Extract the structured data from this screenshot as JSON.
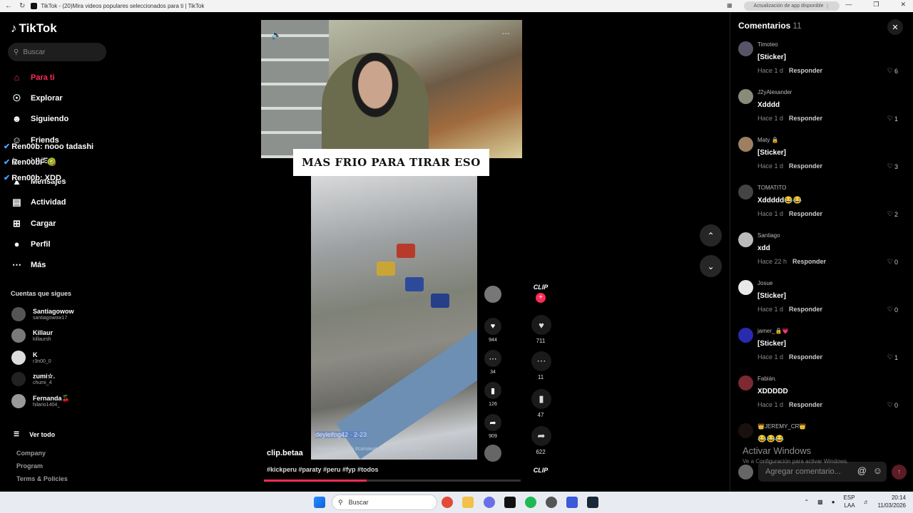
{
  "browser": {
    "title": "TikTok - (20)Mira videos populares seleccionados para ti | TikTok",
    "update_label": "Actualización de app disponible"
  },
  "sidebar": {
    "logo": "TikTok",
    "search_placeholder": "Buscar",
    "nav": [
      {
        "label": "Para ti",
        "icon": "home-icon"
      },
      {
        "label": "Explorar",
        "icon": "compass-icon"
      },
      {
        "label": "Siguiendo",
        "icon": "following-icon"
      },
      {
        "label": "Friends",
        "icon": "friends-icon"
      },
      {
        "label": "LIVE",
        "icon": "live-icon"
      },
      {
        "label": "Mensajes",
        "icon": "messages-icon"
      },
      {
        "label": "Actividad",
        "icon": "activity-icon"
      },
      {
        "label": "Cargar",
        "icon": "upload-icon"
      },
      {
        "label": "Perfil",
        "icon": "profile-icon"
      },
      {
        "label": "Más",
        "icon": "more-icon"
      }
    ],
    "chat_overlay": [
      "Ren00b: nooo tadashi",
      "Ren00bF 🥝",
      "Ren00b: XDD"
    ],
    "following_title": "Cuentas que sigues",
    "following": [
      {
        "name": "Santiagowow",
        "user": "santiagowow17"
      },
      {
        "name": "Killaur",
        "user": "killaursh"
      },
      {
        "name": "K",
        "user": "r3n00_0"
      },
      {
        "name": "zumi☆.",
        "user": "chumi_4"
      },
      {
        "name": "Fernanda🍒",
        "user": "hilario1404_"
      }
    ],
    "see_all": "Ver todo",
    "footer": [
      "Company",
      "Program",
      "Terms & Policies"
    ]
  },
  "video": {
    "caption": "MAS FRIO PARA TIRAR ESO",
    "inner_overlay_user": "deyleifog42 · 2-23",
    "inner_tags": "#cajamarca_perú #camavales#viraltiktok #humor",
    "inner_actions": [
      {
        "icon": "heart-icon",
        "count": "944"
      },
      {
        "icon": "comment-icon",
        "count": "34"
      },
      {
        "icon": "bookmark-icon",
        "count": "126"
      },
      {
        "icon": "share-icon",
        "count": "909"
      }
    ],
    "author": "clip.betaa",
    "hashtags": "#kickperu #paraty #peru #fyp #todos",
    "progress": 0.4
  },
  "actions": {
    "channel_label": "CLIP",
    "likes": "711",
    "comments": "11",
    "saves": "47",
    "shares": "622"
  },
  "comments": {
    "title": "Comentarios",
    "count": "11",
    "items": [
      {
        "user": "Timoteo",
        "text": "[Sticker]",
        "time": "Hace 1 d",
        "likes": "6"
      },
      {
        "user": "J2yAlexander",
        "text": "Xdddd",
        "time": "Hace 1 d",
        "likes": "1"
      },
      {
        "user": "Maty 🔒",
        "text": "[Sticker]",
        "time": "Hace 1 d",
        "likes": "3"
      },
      {
        "user": "TOMATITO",
        "text": "Xddddd😂😂",
        "time": "Hace 1 d",
        "likes": "2"
      },
      {
        "user": "Santiago",
        "text": "xdd",
        "time": "Hace 22 h",
        "likes": "0"
      },
      {
        "user": "Josue",
        "text": "[Sticker]",
        "time": "Hace 1 d",
        "likes": "0"
      },
      {
        "user": "jamer_🔒💗",
        "text": "[Sticker]",
        "time": "Hace 1 d",
        "likes": "1"
      },
      {
        "user": "Fabián.",
        "text": "XDDDDD",
        "time": "Hace 1 d",
        "likes": "0"
      },
      {
        "user": "👑JEREMY_CR👑",
        "text": "😂😂😂",
        "time": "",
        "likes": ""
      }
    ],
    "reply_label": "Responder",
    "input_placeholder": "Agregar comentario...",
    "watermark_title": "Activar Windows",
    "watermark_sub": "Ve a Configuración para activar Windows."
  },
  "taskbar": {
    "search_label": "Buscar",
    "lang_top": "ESP",
    "lang_bottom": "LAA",
    "time": "20:14",
    "date": "11/03/2026"
  }
}
